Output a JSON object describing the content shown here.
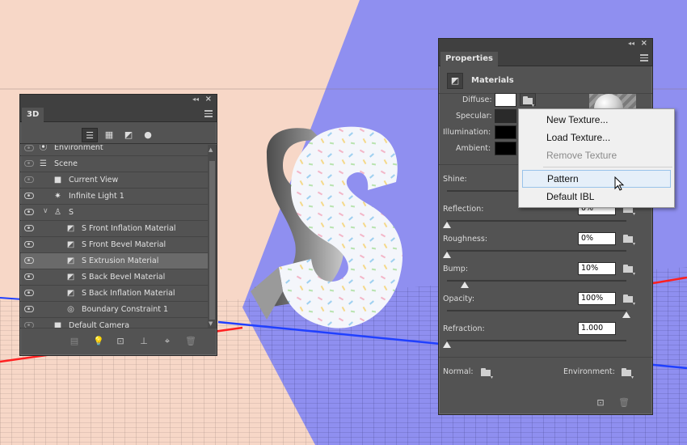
{
  "panel3d": {
    "tab": "3D",
    "filter_icons": [
      "scene-filter-icon",
      "mesh-filter-icon",
      "material-filter-icon",
      "light-filter-icon"
    ],
    "rows": [
      {
        "label": "Environment",
        "icon": "environment-icon",
        "eye": "dim"
      },
      {
        "label": "Scene",
        "icon": "scene-icon",
        "eye": "dim"
      },
      {
        "label": "Current View",
        "icon": "camera-icon",
        "eye": "dim"
      },
      {
        "label": "Infinite Light 1",
        "icon": "light-icon",
        "eye": "on"
      },
      {
        "label": "S",
        "icon": "mesh-icon",
        "eye": "on"
      },
      {
        "label": "S Front Inflation Material",
        "icon": "material-icon",
        "eye": "on"
      },
      {
        "label": "S Front Bevel Material",
        "icon": "material-icon",
        "eye": "on"
      },
      {
        "label": "S Extrusion Material",
        "icon": "material-icon",
        "eye": "on",
        "selected": true
      },
      {
        "label": "S Back Bevel Material",
        "icon": "material-icon",
        "eye": "on"
      },
      {
        "label": "S Back Inflation Material",
        "icon": "material-icon",
        "eye": "on"
      },
      {
        "label": "Boundary Constraint 1",
        "icon": "constraint-icon",
        "eye": "on"
      },
      {
        "label": "Default Camera",
        "icon": "camera-icon",
        "eye": "dim"
      }
    ],
    "footer_icons": [
      "render-icon",
      "add-light-icon",
      "new-object-icon",
      "ground-icon",
      "constraint-tool-icon",
      "delete-icon"
    ]
  },
  "properties": {
    "tab": "Properties",
    "title": "Materials",
    "diffuse_label": "Diffuse:",
    "specular_label": "Specular:",
    "illumination_label": "Illumination:",
    "ambient_label": "Ambient:",
    "diffuse_color": "#ffffff",
    "specular_color": "#2a2a2a",
    "illumination_color": "#000000",
    "ambient_color": "#000000",
    "shine_label": "Shine:",
    "reflection": {
      "label": "Reflection:",
      "value": "0%",
      "slider": 0.0
    },
    "roughness": {
      "label": "Roughness:",
      "value": "0%",
      "slider": 0.0
    },
    "bump": {
      "label": "Bump:",
      "value": "10%",
      "slider": 0.1
    },
    "opacity": {
      "label": "Opacity:",
      "value": "100%",
      "slider": 1.0
    },
    "refraction": {
      "label": "Refraction:",
      "value": "1.000",
      "slider": 0.0
    },
    "normal_label": "Normal:",
    "environment_label": "Environment:"
  },
  "dropdown": {
    "items": [
      {
        "label": "New Texture...",
        "disabled": false
      },
      {
        "label": "Load Texture...",
        "disabled": false
      },
      {
        "label": "Remove Texture",
        "disabled": true
      },
      {
        "label": "Pattern",
        "disabled": false,
        "hover": true
      },
      {
        "label": "Default IBL",
        "disabled": false
      }
    ]
  },
  "colors": {
    "panel_bg": "#535353",
    "scene_peach": "#f7d7c7",
    "scene_blue": "#8f8ff0",
    "axis_red": "#ff2020",
    "axis_blue": "#2040ff"
  }
}
